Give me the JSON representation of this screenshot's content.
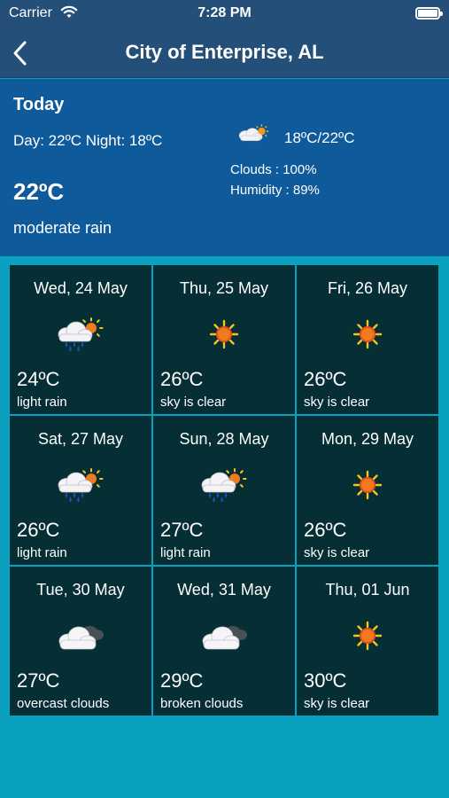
{
  "status": {
    "carrier": "Carrier",
    "time": "7:28 PM"
  },
  "nav": {
    "title": "City of Enterprise, AL"
  },
  "today": {
    "title": "Today",
    "day_night": "Day: 22ºC Night: 18ºC",
    "temp": "22ºC",
    "description": "moderate rain",
    "range": "18ºC/22ºC",
    "clouds": "Clouds : 100%",
    "humidity": "Humidity : 89%",
    "icon": "rain-sun-icon"
  },
  "forecast": [
    {
      "date": "Wed, 24 May",
      "temp": "24ºC",
      "desc": "light rain",
      "icon": "rain-sun-icon"
    },
    {
      "date": "Thu, 25 May",
      "temp": "26ºC",
      "desc": "sky is clear",
      "icon": "sun-icon"
    },
    {
      "date": "Fri, 26 May",
      "temp": "26ºC",
      "desc": "sky is clear",
      "icon": "sun-icon"
    },
    {
      "date": "Sat, 27 May",
      "temp": "26ºC",
      "desc": "light rain",
      "icon": "rain-sun-icon"
    },
    {
      "date": "Sun, 28 May",
      "temp": "27ºC",
      "desc": "light rain",
      "icon": "rain-sun-icon"
    },
    {
      "date": "Mon, 29 May",
      "temp": "26ºC",
      "desc": "sky is clear",
      "icon": "sun-icon"
    },
    {
      "date": "Tue, 30 May",
      "temp": "27ºC",
      "desc": "overcast clouds",
      "icon": "clouds-icon"
    },
    {
      "date": "Wed, 31 May",
      "temp": "29ºC",
      "desc": "broken clouds",
      "icon": "clouds-icon"
    },
    {
      "date": "Thu, 01 Jun",
      "temp": "30ºC",
      "desc": "sky is clear",
      "icon": "sun-icon"
    }
  ],
  "colors": {
    "nav_bg": "#244f79",
    "today_bg": "#0f5a9a",
    "cell_bg": "#062e35",
    "page_bg": "#0aa0c0"
  }
}
